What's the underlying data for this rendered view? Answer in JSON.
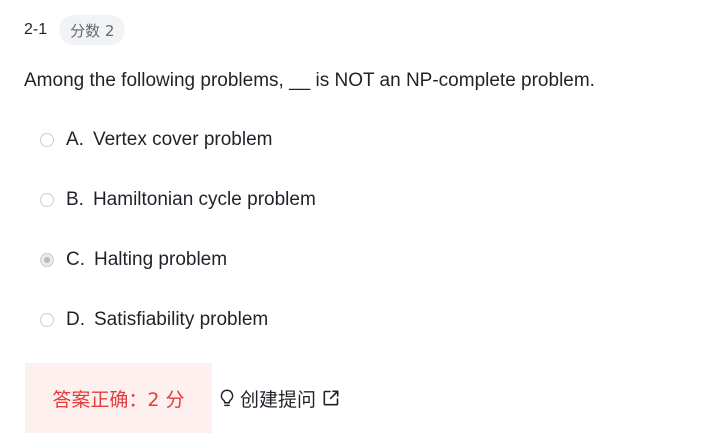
{
  "header": {
    "question_number": "2-1",
    "score_badge": "分数 2"
  },
  "question": {
    "text": "Among the following problems, __ is NOT an NP-complete problem."
  },
  "options": [
    {
      "letter": "A.",
      "text": "Vertex cover problem",
      "selected": false
    },
    {
      "letter": "B.",
      "text": "Hamiltonian cycle problem",
      "selected": false
    },
    {
      "letter": "C.",
      "text": "Halting problem",
      "selected": true
    },
    {
      "letter": "D.",
      "text": "Satisfiability problem",
      "selected": false
    }
  ],
  "footer": {
    "result_text": "答案正确：2 分",
    "create_question_label": "创建提问",
    "result_color": "#e03e3e",
    "result_bg": "#fdf0ef"
  }
}
